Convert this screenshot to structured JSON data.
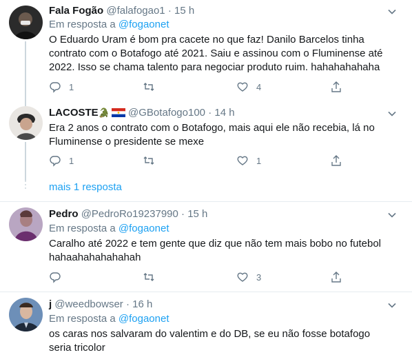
{
  "tweets": [
    {
      "name": "Fala Fogão",
      "handle": "@falafogao1",
      "dot": "·",
      "time": "15 h",
      "reply_prefix": "Em resposta a",
      "reply_to": "@fogaonet",
      "text": "O Eduardo Uram é bom pra cacete no que faz! Danilo Barcelos tinha contrato com o Botafogo até 2021. Saiu e assinou com o Fluminense até 2022. Isso se chama talento para negociar produto ruim. hahahahahaha",
      "replies": "1",
      "retweets": "",
      "likes": "4"
    },
    {
      "name": "LACOSTE",
      "name_emoji": "🐊",
      "flag": "paraguay-flag",
      "handle": "@GBotafogo100",
      "dot": "·",
      "time": "14 h",
      "text": "Era 2 anos o contrato com o Botafogo, mais aqui ele não recebia, lá no Fluminense o presidente se mexe",
      "replies": "1",
      "retweets": "",
      "likes": "1"
    },
    {
      "name": "Pedro",
      "handle": "@PedroRo19237990",
      "dot": "·",
      "time": "15 h",
      "reply_prefix": "Em resposta a",
      "reply_to": "@fogaonet",
      "text": "Caralho até 2022 e tem gente que diz que não tem mais bobo no futebol hahaahahahahahah",
      "replies": "",
      "retweets": "",
      "likes": "3"
    },
    {
      "name": "j",
      "handle": "@weedbowser",
      "dot": "·",
      "time": "16 h",
      "reply_prefix": "Em resposta a",
      "reply_to": "@fogaonet",
      "text": "os caras nos salvaram do valentim e do DB, se eu não fosse botafogo seria tricolor"
    }
  ],
  "more_replies": "mais 1 resposta",
  "icons": {
    "reply": "reply-icon",
    "retweet": "retweet-icon",
    "like": "heart-icon",
    "share": "share-icon",
    "menu": "chevron-down-icon"
  },
  "colors": {
    "accent": "#1da1f2",
    "secondary_text": "#657786",
    "divider": "#e6ecf0",
    "thread_line": "#ccd6dd"
  }
}
